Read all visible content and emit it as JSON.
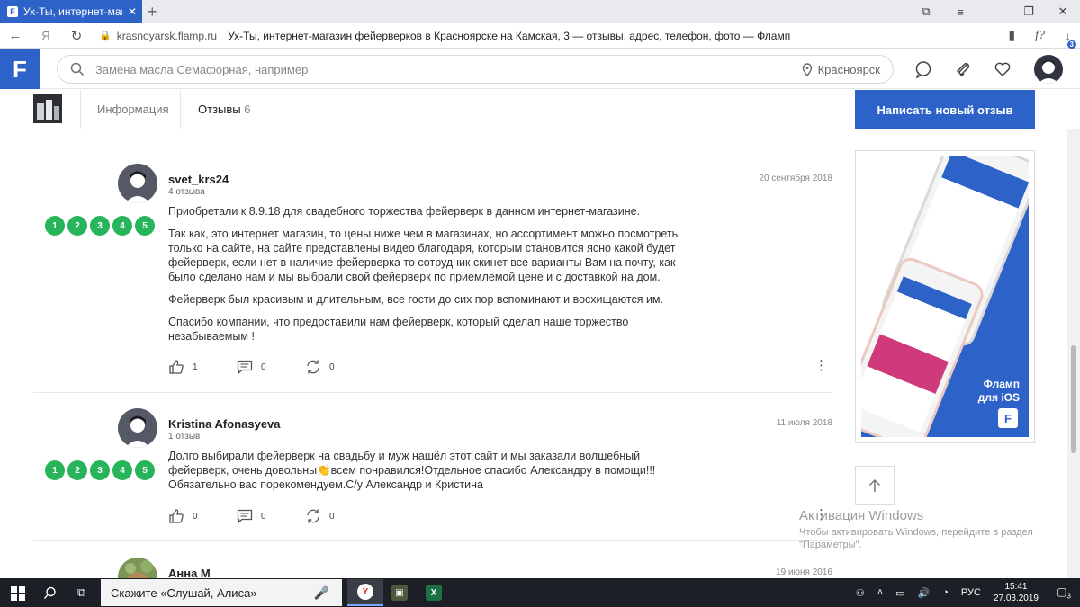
{
  "browser": {
    "tab_title": "Ух-Ты, интернет-магазин",
    "url_host": "krasnoyarsk.flamp.ru",
    "page_title": "Ух-Ты, интернет-магазин фейерверков в Красноярске на Камская, 3 — отзывы, адрес, телефон, фото — Фламп",
    "downloads_badge": "3",
    "reader_label": "f?"
  },
  "site": {
    "logo_letter": "F",
    "search_placeholder": "Замена масла Семафорная, например",
    "city": "Красноярск"
  },
  "subnav": {
    "info_tab": "Информация",
    "reviews_tab": "Отзывы",
    "reviews_count": "6",
    "write_button": "Написать новый отзыв"
  },
  "reviews": [
    {
      "author": "svet_krs24",
      "reviews_count": "4 отзыва",
      "date": "20 сентября 2018",
      "stars": [
        "1",
        "2",
        "3",
        "4",
        "5"
      ],
      "paragraphs": [
        "Приобретали к 8.9.18 для свадебного торжества фейерверк в данном интернет-магазине.",
        "Так как, это интернет магазин, то цены ниже чем в магазинах, но ассортимент можно посмотреть только на сайте, на сайте представлены видео благодаря, которым становится ясно какой будет фейерверк, если нет в наличие фейерверка то сотрудник скинет все варианты Вам на почту, как было сделано нам и мы выбрали свой фейерверк по приемлемой цене и с доставкой на дом.",
        "Фейерверк был красивым и длительным, все гости до сих пор вспоминают и восхищаются им.",
        "Спасибо компании, что предоставили нам фейерверк, который сделал наше торжество незабываемым !"
      ],
      "likes": "1",
      "comments": "0",
      "reposts": "0"
    },
    {
      "author": "Kristina Afonasyeva",
      "reviews_count": "1 отзыв",
      "date": "11 июля 2018",
      "stars": [
        "1",
        "2",
        "3",
        "4",
        "5"
      ],
      "paragraphs": [
        "Долго выбирали фейерверк на свадьбу и муж нашёл этот сайт и мы заказали волшебный фейерверк, очень довольны👏всем понравился!Отдельное спасибо Александру в помощи!!! Обязательно вас порекомендуем.С/у Александр и Кристина"
      ],
      "likes": "0",
      "comments": "0",
      "reposts": "0"
    },
    {
      "author": "Анна М",
      "date": "19 июня 2016"
    }
  ],
  "ad": {
    "title_line1": "Фламп",
    "title_line2": "для iOS"
  },
  "watermark": {
    "title": "Активация Windows",
    "subtitle": "Чтобы активировать Windows, перейдите в раздел \"Параметры\"."
  },
  "taskbar": {
    "search_text": "Скажите «Слушай, Алиса»",
    "lang": "РУС",
    "time": "15:41",
    "date": "27.03.2019",
    "notif_count": "3"
  }
}
